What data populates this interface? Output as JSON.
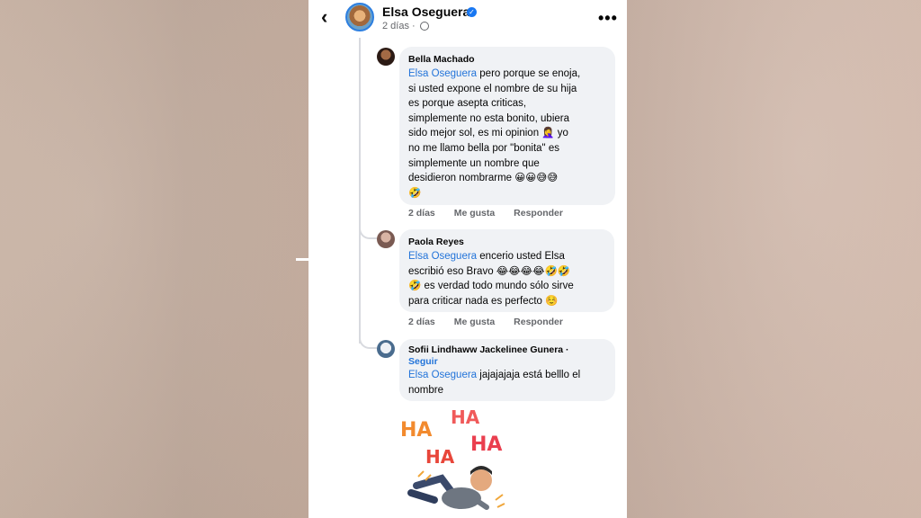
{
  "header": {
    "back_icon": "back-arrow-icon",
    "author": "Elsa Oseguera",
    "timestamp": "2 días ·",
    "more_icon": "more-dots-icon"
  },
  "comments": [
    {
      "author": "Bella Machado",
      "mention": "Elsa Oseguera",
      "lines": [
        " pero porque se enoja,",
        "si usted expone el nombre de su hija",
        "es porque asepta criticas,",
        "simplemente no esta bonito, ubiera",
        "sido mejor sol, es mi opinion 🤦‍♀️ yo",
        "no me llamo bella por \"bonita\" es",
        "simplemente un nombre que",
        "desidieron nombrarme 😀😀😅😅",
        "🤣"
      ],
      "time": "2 días",
      "like": "Me gusta",
      "reply": "Responder"
    },
    {
      "author": "Paola Reyes",
      "mention": "Elsa Oseguera",
      "lines": [
        " encerio usted Elsa",
        "escribió eso Bravo 😂😂😂😂🤣🤣",
        "🤣 es verdad todo mundo sólo sirve",
        "para criticar nada es perfecto ☺️"
      ],
      "time": "2 días",
      "like": "Me gusta",
      "reply": "Responder"
    },
    {
      "author": "Sofii Lindhaww Jackelinee Gunera ·",
      "follow": "Seguir",
      "mention": "Elsa Oseguera",
      "lines": [
        " jajajajaja está belllo el",
        "nombre"
      ]
    }
  ],
  "sticker": {
    "words": [
      "HA",
      "HA",
      "HA",
      "HA"
    ]
  },
  "colors": {
    "mention": "#2374d9",
    "bubble": "#f0f2f5",
    "secondary_text": "#65676b"
  }
}
